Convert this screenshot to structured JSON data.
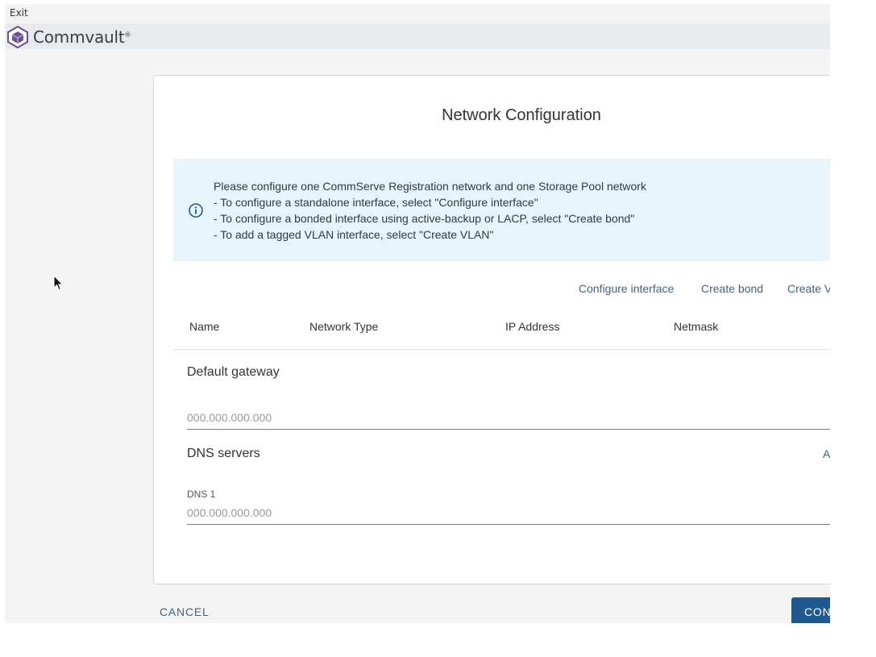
{
  "window": {
    "exit_label": "Exit"
  },
  "brand": {
    "name": "Commvault",
    "mark": "®"
  },
  "dialog": {
    "title": "Network Configuration",
    "info_lines": [
      "Please configure one CommServe Registration network and one Storage Pool network",
      "- To configure a standalone interface, select \"Configure interface\"",
      "- To configure a bonded interface using active-backup or LACP, select \"Create bond\"",
      "- To add a tagged VLAN interface, select \"Create VLAN\""
    ],
    "actions": [
      "Configure interface",
      "Create bond",
      "Create VLAN"
    ],
    "table_headers": [
      "Name",
      "Network Type",
      "IP Address",
      "Netmask"
    ],
    "gateway": {
      "label": "Default gateway",
      "placeholder": "000.000.000.000"
    },
    "dns": {
      "label": "DNS servers",
      "add_label": "Add",
      "field_label": "DNS 1",
      "placeholder": "000.000.000.000"
    }
  },
  "footer": {
    "cancel_label": "CANCEL",
    "confirm_label": "CONFIRM"
  },
  "colors": {
    "accent": "#1f5a8e",
    "link": "#46627a",
    "info_bg": "#e8f4fc",
    "brand_purple": "#6b4f8f"
  }
}
